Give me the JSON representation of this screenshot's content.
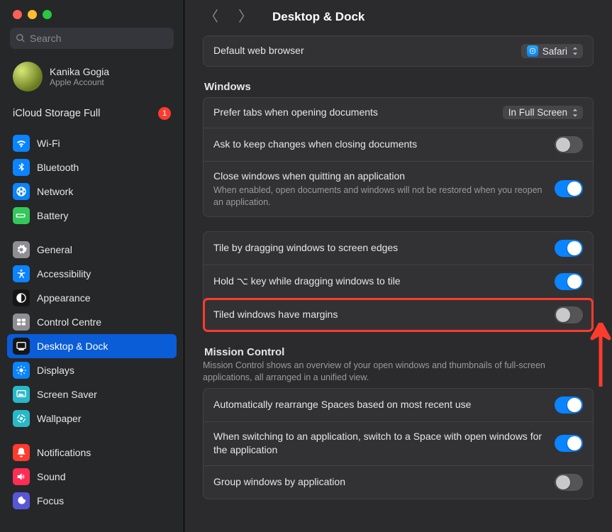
{
  "traffic_lights": [
    "#ff5f57",
    "#febc2e",
    "#28c840"
  ],
  "search": {
    "placeholder": "Search"
  },
  "account": {
    "name": "Kanika Gogia",
    "sub": "Apple Account"
  },
  "storage": {
    "label": "iCloud Storage Full",
    "badge": "1"
  },
  "sidebar": {
    "groups": [
      {
        "items": [
          {
            "id": "wifi",
            "label": "Wi-Fi",
            "icon": "wifi",
            "color": "#0a84ff"
          },
          {
            "id": "bluetooth",
            "label": "Bluetooth",
            "icon": "bluetooth",
            "color": "#0a84ff"
          },
          {
            "id": "network",
            "label": "Network",
            "icon": "network",
            "color": "#0a84ff"
          },
          {
            "id": "battery",
            "label": "Battery",
            "icon": "battery",
            "color": "#34c759"
          }
        ]
      },
      {
        "items": [
          {
            "id": "general",
            "label": "General",
            "icon": "gear",
            "color": "#8e8e93"
          },
          {
            "id": "accessibility",
            "label": "Accessibility",
            "icon": "accessibility",
            "color": "#0a84ff"
          },
          {
            "id": "appearance",
            "label": "Appearance",
            "icon": "appearance",
            "color": "#161616"
          },
          {
            "id": "control-centre",
            "label": "Control Centre",
            "icon": "cc",
            "color": "#8e8e93"
          },
          {
            "id": "desktop-dock",
            "label": "Desktop & Dock",
            "icon": "dock",
            "color": "#161616",
            "selected": true
          },
          {
            "id": "displays",
            "label": "Displays",
            "icon": "displays",
            "color": "#0a84ff"
          },
          {
            "id": "screen-saver",
            "label": "Screen Saver",
            "icon": "screensaver",
            "color": "#28b8c8"
          },
          {
            "id": "wallpaper",
            "label": "Wallpaper",
            "icon": "wallpaper",
            "color": "#28b8c8"
          }
        ]
      },
      {
        "items": [
          {
            "id": "notifications",
            "label": "Notifications",
            "icon": "bell",
            "color": "#ff3b30"
          },
          {
            "id": "sound",
            "label": "Sound",
            "icon": "sound",
            "color": "#ff2d55"
          },
          {
            "id": "focus",
            "label": "Focus",
            "icon": "focus",
            "color": "#5856d6"
          }
        ]
      }
    ]
  },
  "header": {
    "title": "Desktop & Dock"
  },
  "top_row": {
    "label": "Default web browser",
    "value": "Safari"
  },
  "windows_section": {
    "title": "Windows",
    "rows": [
      {
        "id": "prefer-tabs",
        "label": "Prefer tabs when opening documents",
        "control": "dropdown",
        "value": "In Full Screen"
      },
      {
        "id": "ask-keep",
        "label": "Ask to keep changes when closing documents",
        "control": "toggle",
        "on": false
      },
      {
        "id": "close-quit",
        "label": "Close windows when quitting an application",
        "sub": "When enabled, open documents and windows will not be restored when you reopen an application.",
        "control": "toggle",
        "on": true
      }
    ],
    "tile_rows": [
      {
        "id": "tile-drag",
        "label": "Tile by dragging windows to screen edges",
        "control": "toggle",
        "on": true
      },
      {
        "id": "hold-opt",
        "label": "Hold ⌥ key while dragging windows to tile",
        "control": "toggle",
        "on": true
      },
      {
        "id": "margins",
        "label": "Tiled windows have margins",
        "control": "toggle",
        "on": false,
        "highlight": true
      }
    ]
  },
  "mission_section": {
    "title": "Mission Control",
    "sub": "Mission Control shows an overview of your open windows and thumbnails of full-screen applications, all arranged in a unified view.",
    "rows": [
      {
        "id": "auto-spaces",
        "label": "Automatically rearrange Spaces based on most recent use",
        "control": "toggle",
        "on": true
      },
      {
        "id": "switch-space",
        "label": "When switching to an application, switch to a Space with open windows for the application",
        "control": "toggle",
        "on": true
      },
      {
        "id": "group-win",
        "label": "Group windows by application",
        "control": "toggle",
        "on": false
      }
    ]
  }
}
